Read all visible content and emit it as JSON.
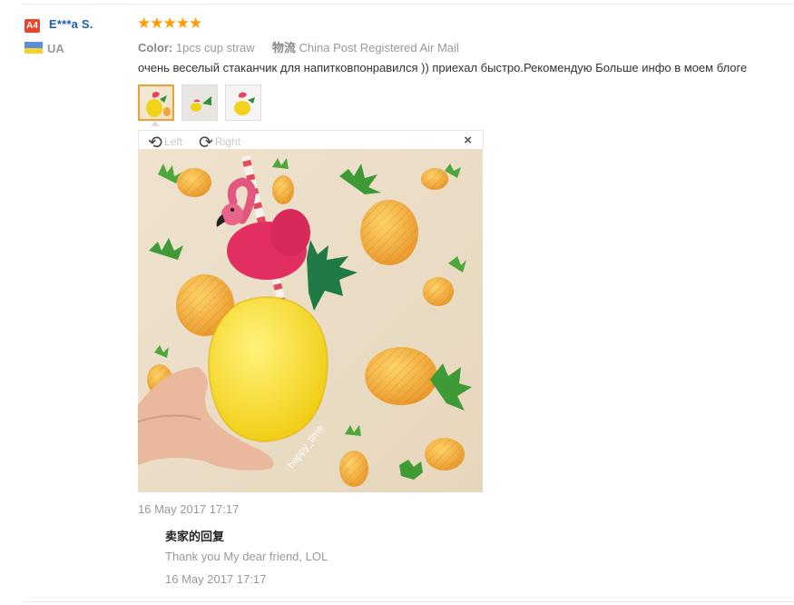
{
  "reviewer": {
    "badge": "A4",
    "name": "E***a S.",
    "country": "UA",
    "flag_colors": [
      "#5b8ed6",
      "#f2d230"
    ]
  },
  "review": {
    "stars": "★★★★★",
    "rating": 5,
    "color_label": "Color:",
    "color_value": "1pcs cup straw",
    "shipping_label": "物流",
    "shipping_value": "China Post Registered Air Mail",
    "text": "очень веселый стаканчик для напитковпонравился )) приехал быстро.Рекомендую Больше инфо в моем блоге",
    "date": "16 May 2017 17:17"
  },
  "viewer": {
    "rotate_left_label": "Left",
    "rotate_right_label": "Right",
    "close_symbol": "×",
    "watermark": "happy_time"
  },
  "seller_reply": {
    "title": "卖家的回复",
    "text": "Thank you My dear friend, LOL",
    "date": "16 May 2017 17:17"
  },
  "colors": {
    "accent_star": "#ff9a00",
    "link_blue": "#1d5fb1",
    "badge_red": "#e8442e",
    "muted_text": "#999999"
  }
}
